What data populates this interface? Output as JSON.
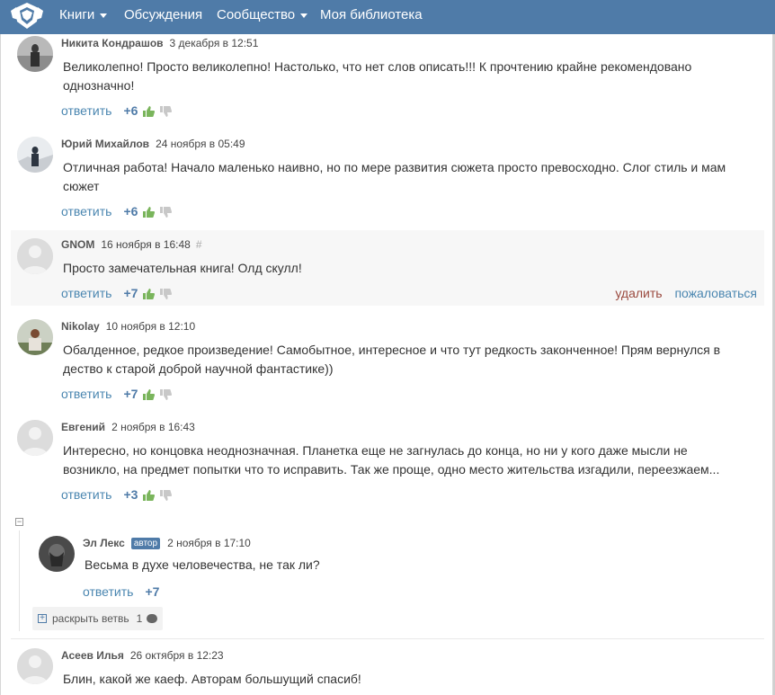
{
  "nav": {
    "items": [
      {
        "label": "Книги",
        "dropdown": true
      },
      {
        "label": "Обсуждения",
        "dropdown": false
      },
      {
        "label": "Сообщество",
        "dropdown": true
      },
      {
        "label": "Моя библиотека",
        "dropdown": false
      }
    ],
    "color": "#4f7ba8"
  },
  "reply_label": "ответить",
  "delete_label": "удалить",
  "report_label": "пожаловаться",
  "comments": [
    {
      "author": "Никита Кондрашов",
      "date": "3 декабря в 12:51",
      "text": "Великолепно! Просто великолепно! Настолько, что нет слов описать!!! К прочтению крайне рекомендовано однозначно!",
      "votes": "+6"
    },
    {
      "author": "Юрий Михайлов",
      "date": "24 ноября в 05:49",
      "text": "Отличная работа! Начало маленько наивно, но по мере развития сюжета просто превосходно. Слог  стиль и мам сюжет",
      "votes": "+6"
    },
    {
      "author": "GNOM",
      "date": "16 ноября в 16:48",
      "hash": "#",
      "text": "Просто замечательная книга! Олд скулл!",
      "votes": "+7"
    },
    {
      "author": "Nikolay",
      "date": "10 ноября в 12:10",
      "text": "Обалденное, редкое произведение! Самобытное, интересное и что тут редкость законченное! Прям вернулся в дество к старой доброй научной фантастике))",
      "votes": "+7"
    },
    {
      "author": "Евгений",
      "date": "2 ноября в 16:43",
      "text": "Интересно, но концовка неоднозначная. Планетка еще не загнулась до конца, но ни у кого даже мысли не возникло, на предмет попытки что то исправить. Так же проще, одно место жительства изгадили, переезжаем...",
      "votes": "+3"
    },
    {
      "author": "Эл Лекс",
      "badge": "автор",
      "date": "2 ноября в 17:10",
      "text": "Весьма в духе человечества, не так ли?",
      "votes": "+7"
    },
    {
      "author": "Асеев Илья",
      "date": "26 октября в 12:23",
      "text": "Блин, какой же каеф. Авторам большущий спасиб!",
      "votes": ""
    }
  ],
  "expand_branch": {
    "label": "раскрыть ветвь",
    "count": "1"
  },
  "collapse_symbol": "−",
  "expand_symbol": "+",
  "icons": [
    "logo-icon",
    "thumb-up-icon",
    "thumb-down-icon",
    "comment-bubble-icon",
    "collapse-icon"
  ]
}
